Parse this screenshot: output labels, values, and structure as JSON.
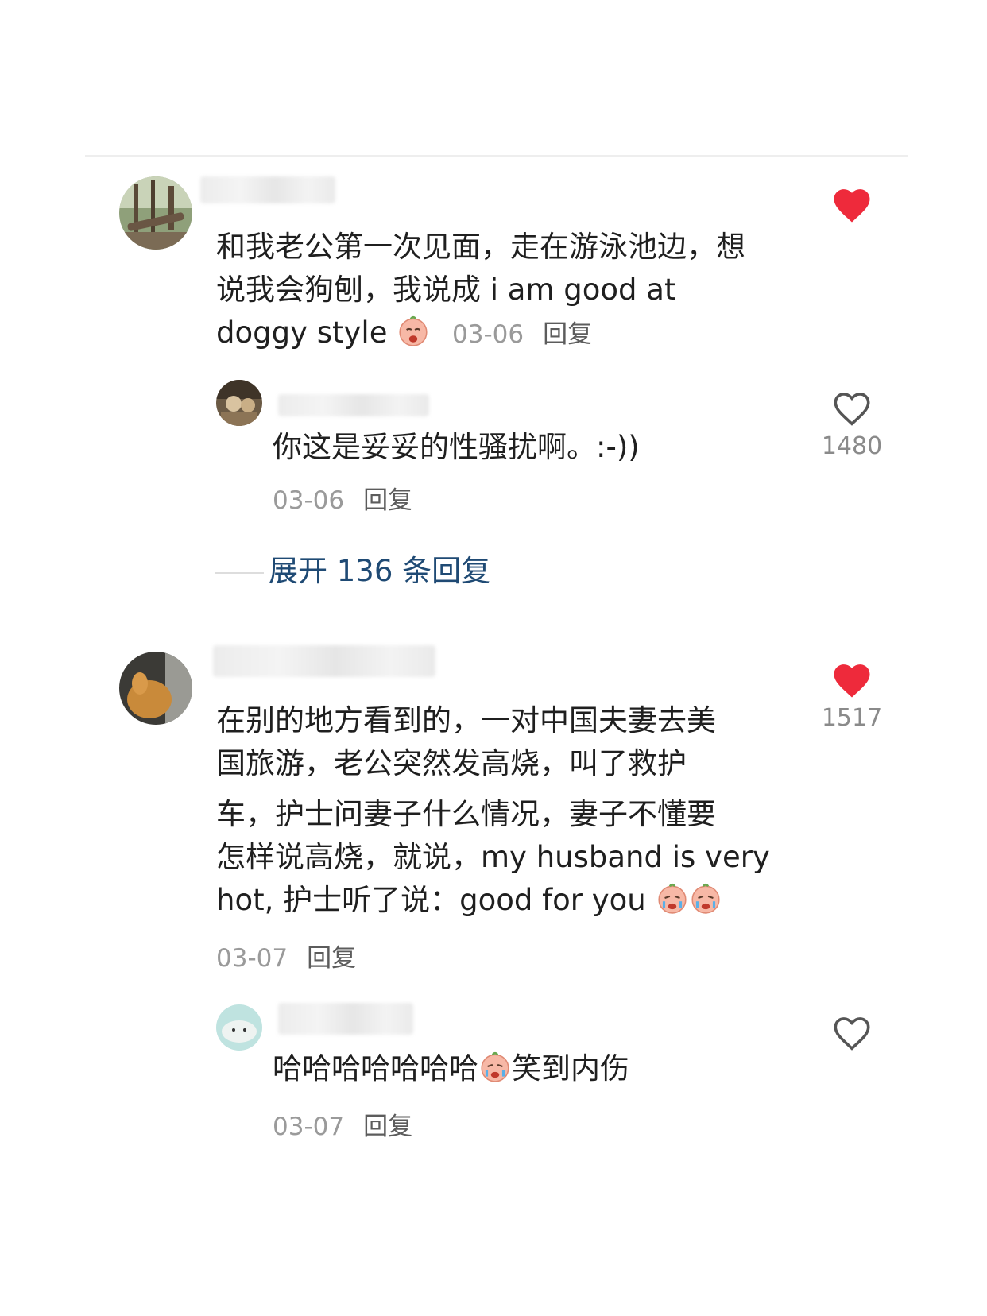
{
  "comments": [
    {
      "text": "和我老公第一次见面，走在游泳池边，想说我会狗刨，我说成 i am good at doggy style",
      "date": "03-06",
      "reply_label": "回复",
      "liked": true,
      "like_count": "",
      "replies": [
        {
          "text": "你这是妥妥的性骚扰啊。:-))",
          "date": "03-06",
          "reply_label": "回复",
          "liked": false,
          "like_count": "1480"
        }
      ],
      "expand_label": "展开 136 条回复"
    },
    {
      "text_lines": [
        "在别的地方看到的，一对中国夫妻去美",
        "国旅游，老公突然发高烧，叫了救护",
        "车，护士问妻子什么情况，妻子不懂要",
        "怎样说高烧，就说，my husband is very",
        "hot, 护士听了说：good for you"
      ],
      "date": "03-07",
      "reply_label": "回复",
      "liked": true,
      "like_count": "1517",
      "replies": [
        {
          "text_before": "哈哈哈哈哈哈哈",
          "text_after": "笑到内伤",
          "date": "03-07",
          "reply_label": "回复",
          "liked": false,
          "like_count": ""
        }
      ]
    }
  ],
  "colors": {
    "heart_red": "#ee2a3b",
    "expand_blue": "#1f4a74",
    "meta_gray": "#9a9a9a"
  },
  "icons": {
    "liked": "heart-filled-icon",
    "unliked": "heart-outline-icon",
    "emoji": "crying-face-emoji"
  }
}
